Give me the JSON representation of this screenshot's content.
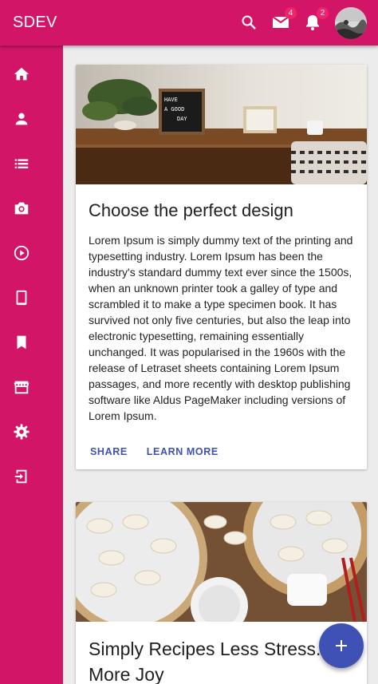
{
  "app": {
    "brand": "SDEV"
  },
  "header": {
    "mail_count": "4",
    "notification_count": "2"
  },
  "sidebar": {
    "items": [
      {
        "icon": "home-icon"
      },
      {
        "icon": "person-icon"
      },
      {
        "icon": "list-icon"
      },
      {
        "icon": "camera-icon"
      },
      {
        "icon": "play-circle-icon"
      },
      {
        "icon": "tablet-icon"
      },
      {
        "icon": "bookmark-icon"
      },
      {
        "icon": "store-icon"
      },
      {
        "icon": "settings-icon"
      },
      {
        "icon": "logout-icon"
      }
    ]
  },
  "cards": [
    {
      "image_sign_lines": [
        "HAVE",
        "A GOOD",
        "DAY"
      ],
      "title": "Choose the perfect design",
      "body": "Lorem Ipsum is simply dummy text of the printing and typesetting industry. Lorem Ipsum has been the industry's standard dummy text ever since the 1500s, when an unknown printer took a galley of type and scrambled it to make a type specimen book. It has survived not only five centuries, but also the leap into electronic typesetting, remaining essentially unchanged. It was popularised in the 1960s with the release of Letraset sheets containing Lorem Ipsum passages, and more recently with desktop publishing software like Aldus PageMaker including versions of Lorem Ipsum.",
      "actions": [
        "SHARE",
        "LEARN MORE"
      ]
    },
    {
      "title_line1": "Simply Recipes Less Stress.",
      "title_line2": "More Joy"
    }
  ],
  "colors": {
    "primary": "#d31568",
    "accent": "#3f51b5",
    "badge": "#f0246b",
    "background": "#ececec"
  }
}
